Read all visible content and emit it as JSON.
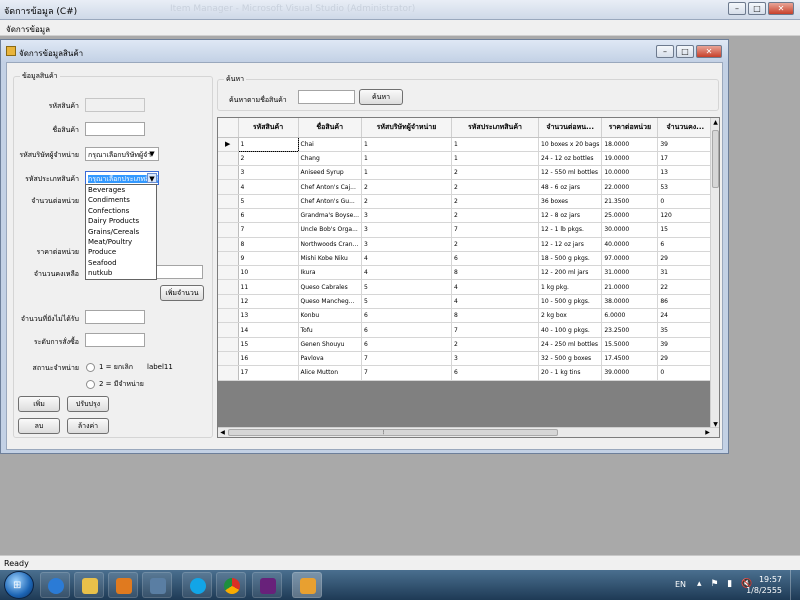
{
  "app": {
    "title": "จัดการข้อมูล (C#)",
    "background_title": "Item Manager - Microsoft Visual Studio (Administrator)",
    "menu_item": "จัดการข้อมูล"
  },
  "child_window": {
    "title": "จัดการข้อมูลสินค้า"
  },
  "product_group": {
    "title": "ข้อมูลสินค้า",
    "product_id_label": "รหัสสินค้า",
    "product_name_label": "ชื่อสินค้า",
    "supplier_label": "รหัสบริษัทผู้จำหน่าย",
    "supplier_value": "กรุณาเลือกบริษัทผู้จำ",
    "category_label": "รหัสประเภทสินค้า",
    "category_value": "กรุณาเลือกประเภทสินค้า",
    "category_options": [
      "Beverages",
      "Condiments",
      "Confections",
      "Dairy Products",
      "Grains/Cereals",
      "Meat/Poultry",
      "Produce",
      "Seafood",
      "nutkub"
    ],
    "qty_per_unit_label": "จำนวนต่อหน่วย",
    "unit_price_label": "ราคาต่อหน่วย",
    "units_in_stock_label": "จำนวนคงเหลือ",
    "add_qty_button": "เพิ่มจำนวน",
    "units_on_order_label": "จำนวนที่ยังไม่ได้รับ",
    "reorder_level_label": "ระดับการสั่งซื้อ",
    "sale_status_label": "สถานะจำหน่าย",
    "radio_cancel": "1 = ยกเลิก",
    "radio_sale": "2 = มีจำหน่าย",
    "status_label": "label11",
    "add_button": "เพิ่ม",
    "update_button": "ปรับปรุง",
    "delete_button": "ลบ",
    "clear_button": "ล้างค่า"
  },
  "search_group": {
    "title": "ค้นหา",
    "label": "ค้นหาตามชื่อสินค้า",
    "button": "ค้นหา"
  },
  "grid": {
    "columns": [
      "รหัสสินค้า",
      "ชื่อสินค้า",
      "รหัสบริษัทผู้จำหน่าย",
      "รหัสประเภทสินค้า",
      "จำนวนต่อหน...",
      "ราคาต่อหน่วย",
      "จำนวนคง..."
    ],
    "rows": [
      [
        "1",
        "Chai",
        "1",
        "1",
        "10 boxes x 20 bags",
        "18.0000",
        "39"
      ],
      [
        "2",
        "Chang",
        "1",
        "1",
        "24 - 12 oz bottles",
        "19.0000",
        "17"
      ],
      [
        "3",
        "Aniseed Syrup",
        "1",
        "2",
        "12 - 550 ml bottles",
        "10.0000",
        "13"
      ],
      [
        "4",
        "Chef Anton's Caj...",
        "2",
        "2",
        "48 - 6 oz jars",
        "22.0000",
        "53"
      ],
      [
        "5",
        "Chef Anton's Gu...",
        "2",
        "2",
        "36 boxes",
        "21.3500",
        "0"
      ],
      [
        "6",
        "Grandma's Boyse...",
        "3",
        "2",
        "12 - 8 oz jars",
        "25.0000",
        "120"
      ],
      [
        "7",
        "Uncle Bob's Orga...",
        "3",
        "7",
        "12 - 1 lb pkgs.",
        "30.0000",
        "15"
      ],
      [
        "8",
        "Northwoods Cran...",
        "3",
        "2",
        "12 - 12 oz jars",
        "40.0000",
        "6"
      ],
      [
        "9",
        "Mishi Kobe Niku",
        "4",
        "6",
        "18 - 500 g pkgs.",
        "97.0000",
        "29"
      ],
      [
        "10",
        "Ikura",
        "4",
        "8",
        "12 - 200 ml jars",
        "31.0000",
        "31"
      ],
      [
        "11",
        "Queso Cabrales",
        "5",
        "4",
        "1 kg pkg.",
        "21.0000",
        "22"
      ],
      [
        "12",
        "Queso Mancheg...",
        "5",
        "4",
        "10 - 500 g pkgs.",
        "38.0000",
        "86"
      ],
      [
        "13",
        "Konbu",
        "6",
        "8",
        "2 kg box",
        "6.0000",
        "24"
      ],
      [
        "14",
        "Tofu",
        "6",
        "7",
        "40 - 100 g pkgs.",
        "23.2500",
        "35"
      ],
      [
        "15",
        "Genen Shouyu",
        "6",
        "2",
        "24 - 250 ml bottles",
        "15.5000",
        "39"
      ],
      [
        "16",
        "Pavlova",
        "7",
        "3",
        "32 - 500 g boxes",
        "17.4500",
        "29"
      ],
      [
        "17",
        "Alice Mutton",
        "7",
        "6",
        "20 - 1 kg tins",
        "39.0000",
        "0"
      ]
    ],
    "current_row_marker": "▶"
  },
  "statusbar": {
    "text": "Ready"
  },
  "taskbar": {
    "lang": "EN",
    "time": "19:57",
    "date": "1/8/2555"
  }
}
